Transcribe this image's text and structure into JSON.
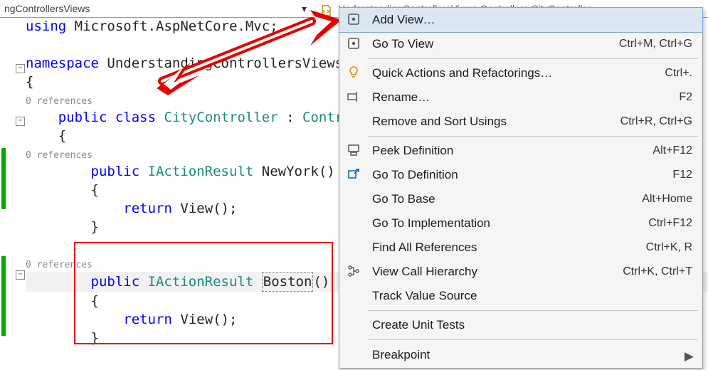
{
  "tab": {
    "left_title": "ngControllersViews",
    "dropdown_glyph": "▾",
    "right_title": "UnderstandingControllersViews.Controllers.CityController"
  },
  "code": {
    "using_kw": "using",
    "using_ns": " Microsoft.AspNetCore.Mvc;",
    "namespace_kw": "namespace",
    "namespace_name": " UnderstandingControllersViews.Controllers",
    "open_brace": "{",
    "close_brace": "}",
    "codelens": "0 references",
    "public_kw": "public",
    "class_kw": "class",
    "return_kw": "return",
    "class_name": "CityController",
    "colon": " : ",
    "base_name": "Controller",
    "ret_type": "IActionResult",
    "method1": "NewYork",
    "method2": "Boston",
    "parens": "()",
    "view_call": "View",
    "semicolon": ";"
  },
  "menu": {
    "add_view": "Add View…",
    "go_to_view": "Go To View",
    "go_to_view_sc": "Ctrl+M, Ctrl+G",
    "quick_actions": "Quick Actions and Refactorings…",
    "quick_actions_sc": "Ctrl+.",
    "rename": "Rename…",
    "rename_sc": "F2",
    "remove_usings": "Remove and Sort Usings",
    "remove_usings_sc": "Ctrl+R, Ctrl+G",
    "peek_def": "Peek Definition",
    "peek_def_sc": "Alt+F12",
    "go_to_def": "Go To Definition",
    "go_to_def_sc": "F12",
    "go_to_base": "Go To Base",
    "go_to_base_sc": "Alt+Home",
    "go_to_impl": "Go To Implementation",
    "go_to_impl_sc": "Ctrl+F12",
    "find_refs": "Find All References",
    "find_refs_sc": "Ctrl+K, R",
    "call_hier": "View Call Hierarchy",
    "call_hier_sc": "Ctrl+K, Ctrl+T",
    "track_value": "Track Value Source",
    "unit_tests": "Create Unit Tests",
    "breakpoint": "Breakpoint"
  }
}
